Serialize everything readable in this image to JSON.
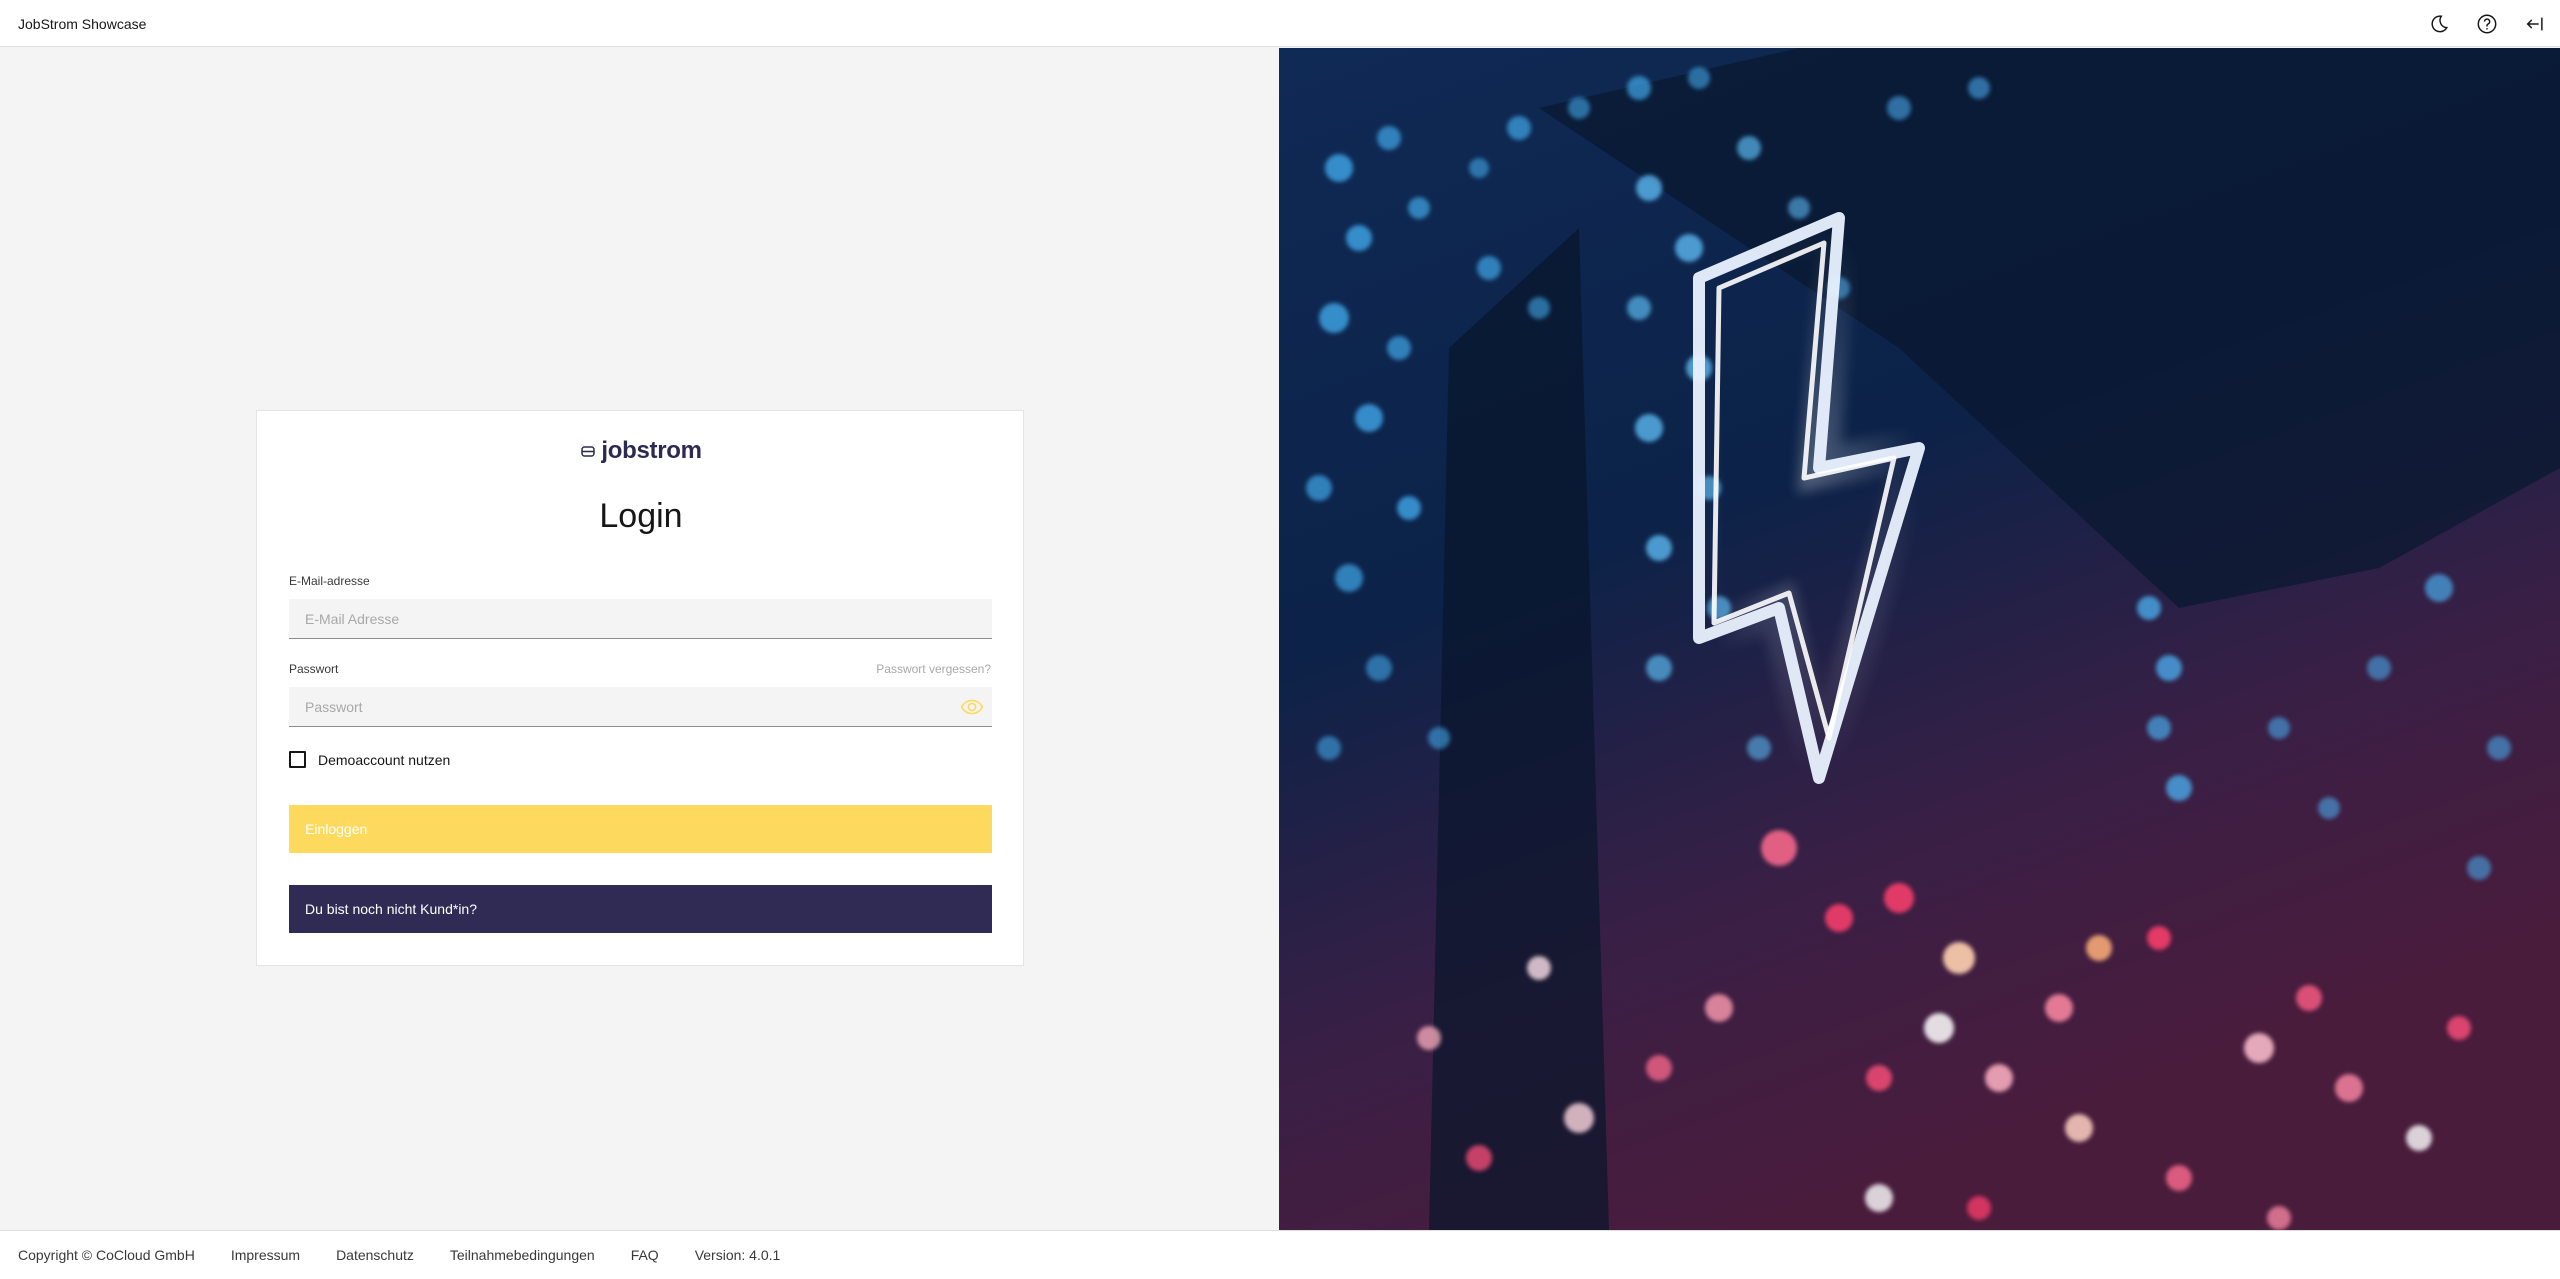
{
  "header": {
    "app_title": "JobStrom Showcase",
    "icons": [
      "moon-icon",
      "help-icon",
      "logout-icon"
    ]
  },
  "card": {
    "logo_text": "jobstrom",
    "title": "Login",
    "email": {
      "label": "E-Mail-adresse",
      "placeholder": "E-Mail Adresse",
      "value": ""
    },
    "password": {
      "label": "Passwort",
      "placeholder": "Passwort",
      "value": "",
      "forgot_link": "Passwort vergessen?"
    },
    "demo_checkbox": {
      "label": "Demoaccount nutzen",
      "checked": false
    },
    "login_button": "Einloggen",
    "register_button": "Du bist noch nicht Kund*in?"
  },
  "colors": {
    "accent_yellow": "#fdd95e",
    "brand_navy": "#2f2b54"
  },
  "footer": {
    "copyright": "Copyright © CoCloud GmbH",
    "links": [
      "Impressum",
      "Datenschutz",
      "Teilnahmebedingungen",
      "FAQ"
    ],
    "version": "Version: 4.0.1"
  }
}
